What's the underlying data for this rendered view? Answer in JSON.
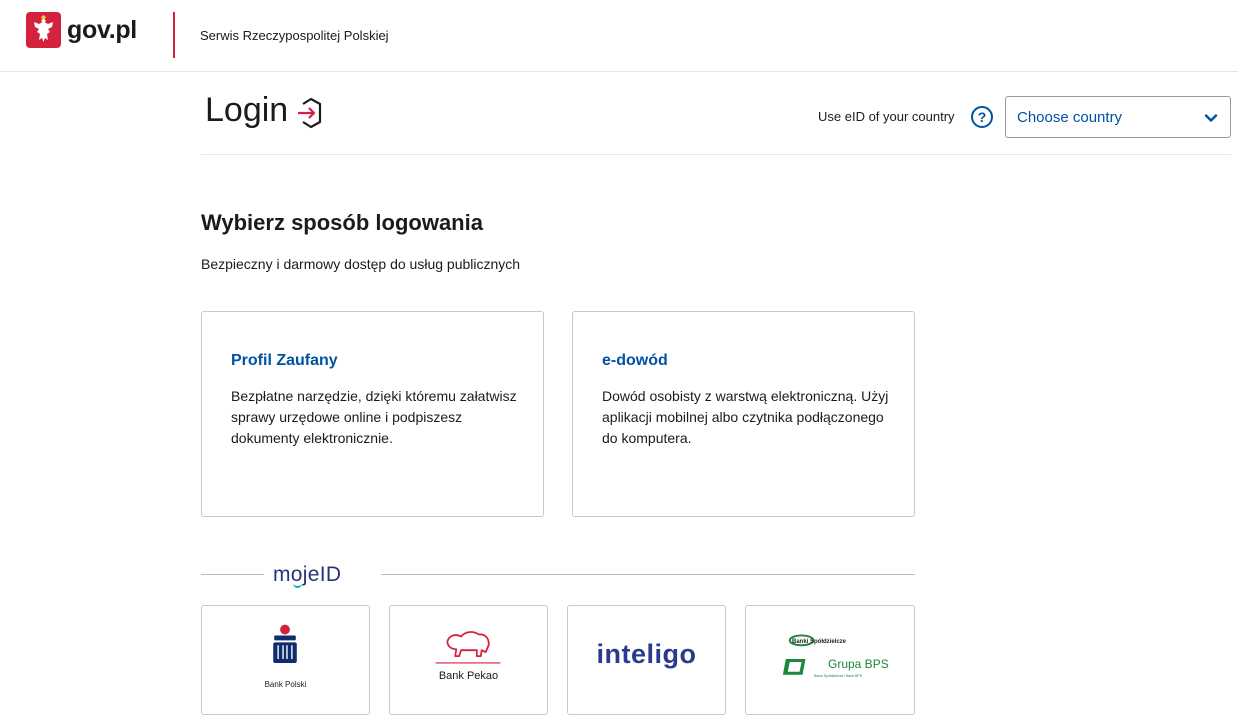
{
  "header": {
    "logo_text": "gov.pl",
    "subtitle": "Serwis Rzeczypospolitej Polskiej"
  },
  "login_bar": {
    "title": "Login",
    "eid_label": "Use eID of your country",
    "help_glyph": "?",
    "country_select": {
      "value": "Choose country"
    }
  },
  "main": {
    "title": "Wybierz sposób logowania",
    "subtitle": "Bezpieczny i darmowy dostęp do usług publicznych",
    "cards": [
      {
        "title": "Profil Zaufany",
        "description": "Bezpłatne narzędzie, dzięki któremu załatwisz sprawy urzędowe online i podpiszesz dokumenty elektronicznie."
      },
      {
        "title": "e-dowód",
        "description": "Dowód osobisty z warstwą elektroniczną. Użyj aplikacji mobilnej albo czytnika podłączonego do komputera."
      }
    ]
  },
  "mojeid": {
    "logo_prefix": "m",
    "logo_o": "o",
    "logo_suffix": "jeID",
    "banks": [
      {
        "name": "Bank Polski",
        "icon": "pko-bp-logo"
      },
      {
        "name": "Bank Pekao",
        "icon": "pekao-bison-logo"
      },
      {
        "name": "inteligo",
        "icon": "inteligo-logo"
      },
      {
        "name": "Banki Spółdzielcze",
        "badge": "SGB",
        "group": "Grupa BPS",
        "sub": "Banki Spółdzielcze i Bank BPS",
        "icon": "sgb-bps-logo"
      }
    ]
  },
  "colors": {
    "brand_red": "#d4213d",
    "link_blue": "#0052a5",
    "mojeid_navy": "#25337a",
    "bps_green": "#1a8a3a"
  }
}
